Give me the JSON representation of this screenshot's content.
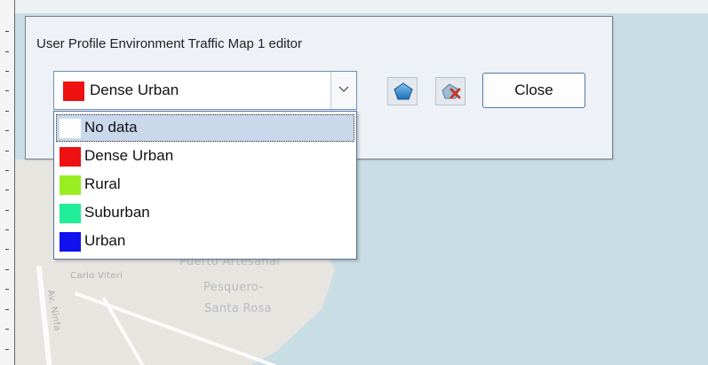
{
  "dialog": {
    "title": "User Profile Environment Traffic Map 1 editor",
    "selected_value": "Dense Urban",
    "selected_color": "#ee1111",
    "close_label": "Close",
    "icons": [
      "draw-polygon-icon",
      "delete-polygon-icon"
    ]
  },
  "dropdown": {
    "items": [
      {
        "label": "No data",
        "color": "#ffffff"
      },
      {
        "label": "Dense Urban",
        "color": "#ee1111"
      },
      {
        "label": "Rural",
        "color": "#99ee22"
      },
      {
        "label": "Suburban",
        "color": "#22ee99"
      },
      {
        "label": "Urban",
        "color": "#1111ee"
      }
    ]
  },
  "map": {
    "place_labels": [
      "Puerto Artesanal",
      "Pesquero-",
      "Santa Rosa",
      "Carlo Viteri",
      "Av. Ninfa"
    ]
  },
  "colors": {
    "water": "#c9dde4",
    "land": "#e6e5e0",
    "dialog_bg": "#eef1f6",
    "accent_border": "#4b79ad"
  }
}
